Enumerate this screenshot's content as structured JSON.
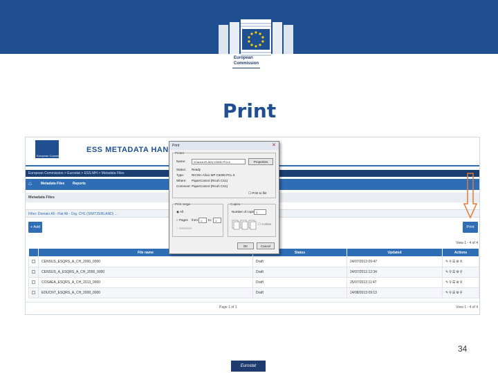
{
  "header": {
    "org_line1": "European",
    "org_line2": "Commission",
    "colors": {
      "band": "#1f4f91",
      "accent": "#2f6db5"
    }
  },
  "slide": {
    "title": "Print",
    "page_number": "34",
    "footer_badge": "Eurostat"
  },
  "app": {
    "title": "ESS METADATA HANDLER",
    "logo_caption": "European Commission",
    "breadcrumb": "European Commission > Eurostat > ESS-MH > Metadata Files",
    "nav": {
      "home_icon": "home-icon",
      "items": [
        "Metadata Files",
        "Reports"
      ]
    },
    "section_title": "Metadata Files",
    "filter": "Filter: Domain All - Flat All - Org. CH1 (SWITZERLAND) ...",
    "add_label": "+ Add",
    "print_label": "Print",
    "view_info_top": "View 1 - 4 of 4",
    "view_info_bottom": "View 1 - 4 of 4",
    "pager_bottom": "Page 1 of 1",
    "columns": [
      "",
      "File name",
      "Status",
      "Updated",
      "Actions"
    ],
    "rows": [
      {
        "file": "CENSUS_ESQRS_A_CH_2000_0000",
        "status": "Draft",
        "updated": "24/07/2013 09:47",
        "actions": "✎⚲☰⚙⚲"
      },
      {
        "file": "CENSUS_A_ESQRS_A_CH_2000_0000",
        "status": "Draft",
        "updated": "24/07/2013 12:34",
        "actions": "✎⚲☰⚙⚲"
      },
      {
        "file": "COSAEA_ESQRS_A_CH_2013_0000",
        "status": "Draft",
        "updated": "25/07/2013 11:47",
        "actions": "✎⚲☰⚙⚲"
      },
      {
        "file": "EDUCNT_ESQRS_A_CH_2000_0000",
        "status": "Draft",
        "updated": "14/08/2013 09:13",
        "actions": "✎⚲☰⚙⚲"
      }
    ]
  },
  "print_dialog": {
    "title": "Print",
    "printer_group": "Printer",
    "name_label": "Name:",
    "name_value": "\\\\Canon-iR-ADV-C5030 PCL6",
    "properties": "Properties",
    "status_label": "Status:",
    "status_value": "Ready",
    "type_label": "Type:",
    "type_value": "RICOH Aficio MP C5000 PCL 6",
    "where_label": "Where:",
    "where_value": "PaperControl (Ricoh CS1)",
    "comment_label": "Comment:",
    "comment_value": "PaperControl (Ricoh CS1)",
    "print_to_file": "Print to file",
    "range_group": "Print range",
    "range_all": "All",
    "range_pages": "Pages",
    "from": "from:",
    "to": "to:",
    "from_value": "1",
    "to_value": "1",
    "range_selection": "Selection",
    "copies_group": "Copies",
    "copies_label": "Number of copies:",
    "copies_value": "1",
    "collate": "Collate",
    "ok": "OK",
    "cancel": "Cancel"
  }
}
